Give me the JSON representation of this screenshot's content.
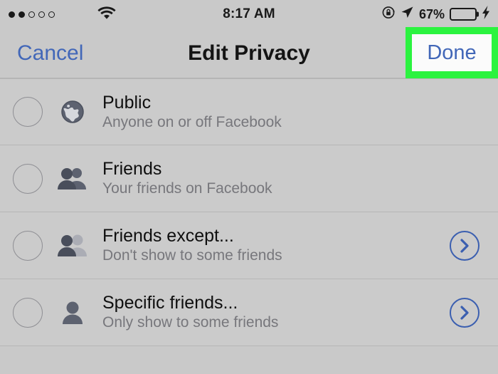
{
  "status_bar": {
    "signal_dots": {
      "total": 5,
      "filled": 2
    },
    "wifi_icon": "wifi-icon",
    "time": "8:17 AM",
    "rotation_lock_icon": "rotation-lock-icon",
    "location_icon": "location-arrow-icon",
    "battery_percent": "67%",
    "battery_level": 67,
    "charging": true,
    "charging_icon": "lightning-bolt-icon"
  },
  "nav_bar": {
    "cancel_label": "Cancel",
    "title": "Edit Privacy",
    "done_label": "Done",
    "highlight_color": "#2bf33f",
    "link_color": "#4267b8"
  },
  "privacy_options": [
    {
      "title": "Public",
      "subtitle": "Anyone on or off Facebook",
      "icon": "globe-icon",
      "selected": false,
      "has_disclosure": false
    },
    {
      "title": "Friends",
      "subtitle": "Your friends on Facebook",
      "icon": "two-people-icon",
      "selected": false,
      "has_disclosure": false
    },
    {
      "title": "Friends except...",
      "subtitle": "Don't show to some friends",
      "icon": "two-people-one-excluded-icon",
      "selected": false,
      "has_disclosure": true
    },
    {
      "title": "Specific friends...",
      "subtitle": "Only show to some friends",
      "icon": "single-person-icon",
      "selected": false,
      "has_disclosure": true
    }
  ]
}
